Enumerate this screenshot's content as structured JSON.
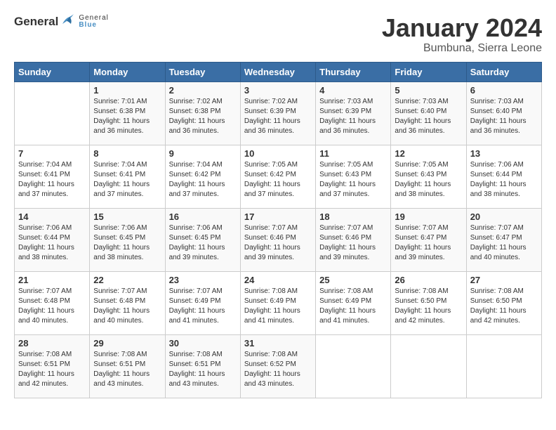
{
  "logo": {
    "general": "General",
    "blue": "Blue"
  },
  "title": "January 2024",
  "subtitle": "Bumbuna, Sierra Leone",
  "days_of_week": [
    "Sunday",
    "Monday",
    "Tuesday",
    "Wednesday",
    "Thursday",
    "Friday",
    "Saturday"
  ],
  "weeks": [
    [
      {
        "day": "",
        "info": ""
      },
      {
        "day": "1",
        "info": "Sunrise: 7:01 AM\nSunset: 6:38 PM\nDaylight: 11 hours and 36 minutes."
      },
      {
        "day": "2",
        "info": "Sunrise: 7:02 AM\nSunset: 6:38 PM\nDaylight: 11 hours and 36 minutes."
      },
      {
        "day": "3",
        "info": "Sunrise: 7:02 AM\nSunset: 6:39 PM\nDaylight: 11 hours and 36 minutes."
      },
      {
        "day": "4",
        "info": "Sunrise: 7:03 AM\nSunset: 6:39 PM\nDaylight: 11 hours and 36 minutes."
      },
      {
        "day": "5",
        "info": "Sunrise: 7:03 AM\nSunset: 6:40 PM\nDaylight: 11 hours and 36 minutes."
      },
      {
        "day": "6",
        "info": "Sunrise: 7:03 AM\nSunset: 6:40 PM\nDaylight: 11 hours and 36 minutes."
      }
    ],
    [
      {
        "day": "7",
        "info": "Sunrise: 7:04 AM\nSunset: 6:41 PM\nDaylight: 11 hours and 37 minutes."
      },
      {
        "day": "8",
        "info": "Sunrise: 7:04 AM\nSunset: 6:41 PM\nDaylight: 11 hours and 37 minutes."
      },
      {
        "day": "9",
        "info": "Sunrise: 7:04 AM\nSunset: 6:42 PM\nDaylight: 11 hours and 37 minutes."
      },
      {
        "day": "10",
        "info": "Sunrise: 7:05 AM\nSunset: 6:42 PM\nDaylight: 11 hours and 37 minutes."
      },
      {
        "day": "11",
        "info": "Sunrise: 7:05 AM\nSunset: 6:43 PM\nDaylight: 11 hours and 37 minutes."
      },
      {
        "day": "12",
        "info": "Sunrise: 7:05 AM\nSunset: 6:43 PM\nDaylight: 11 hours and 38 minutes."
      },
      {
        "day": "13",
        "info": "Sunrise: 7:06 AM\nSunset: 6:44 PM\nDaylight: 11 hours and 38 minutes."
      }
    ],
    [
      {
        "day": "14",
        "info": "Sunrise: 7:06 AM\nSunset: 6:44 PM\nDaylight: 11 hours and 38 minutes."
      },
      {
        "day": "15",
        "info": "Sunrise: 7:06 AM\nSunset: 6:45 PM\nDaylight: 11 hours and 38 minutes."
      },
      {
        "day": "16",
        "info": "Sunrise: 7:06 AM\nSunset: 6:45 PM\nDaylight: 11 hours and 39 minutes."
      },
      {
        "day": "17",
        "info": "Sunrise: 7:07 AM\nSunset: 6:46 PM\nDaylight: 11 hours and 39 minutes."
      },
      {
        "day": "18",
        "info": "Sunrise: 7:07 AM\nSunset: 6:46 PM\nDaylight: 11 hours and 39 minutes."
      },
      {
        "day": "19",
        "info": "Sunrise: 7:07 AM\nSunset: 6:47 PM\nDaylight: 11 hours and 39 minutes."
      },
      {
        "day": "20",
        "info": "Sunrise: 7:07 AM\nSunset: 6:47 PM\nDaylight: 11 hours and 40 minutes."
      }
    ],
    [
      {
        "day": "21",
        "info": "Sunrise: 7:07 AM\nSunset: 6:48 PM\nDaylight: 11 hours and 40 minutes."
      },
      {
        "day": "22",
        "info": "Sunrise: 7:07 AM\nSunset: 6:48 PM\nDaylight: 11 hours and 40 minutes."
      },
      {
        "day": "23",
        "info": "Sunrise: 7:07 AM\nSunset: 6:49 PM\nDaylight: 11 hours and 41 minutes."
      },
      {
        "day": "24",
        "info": "Sunrise: 7:08 AM\nSunset: 6:49 PM\nDaylight: 11 hours and 41 minutes."
      },
      {
        "day": "25",
        "info": "Sunrise: 7:08 AM\nSunset: 6:49 PM\nDaylight: 11 hours and 41 minutes."
      },
      {
        "day": "26",
        "info": "Sunrise: 7:08 AM\nSunset: 6:50 PM\nDaylight: 11 hours and 42 minutes."
      },
      {
        "day": "27",
        "info": "Sunrise: 7:08 AM\nSunset: 6:50 PM\nDaylight: 11 hours and 42 minutes."
      }
    ],
    [
      {
        "day": "28",
        "info": "Sunrise: 7:08 AM\nSunset: 6:51 PM\nDaylight: 11 hours and 42 minutes."
      },
      {
        "day": "29",
        "info": "Sunrise: 7:08 AM\nSunset: 6:51 PM\nDaylight: 11 hours and 43 minutes."
      },
      {
        "day": "30",
        "info": "Sunrise: 7:08 AM\nSunset: 6:51 PM\nDaylight: 11 hours and 43 minutes."
      },
      {
        "day": "31",
        "info": "Sunrise: 7:08 AM\nSunset: 6:52 PM\nDaylight: 11 hours and 43 minutes."
      },
      {
        "day": "",
        "info": ""
      },
      {
        "day": "",
        "info": ""
      },
      {
        "day": "",
        "info": ""
      }
    ]
  ]
}
